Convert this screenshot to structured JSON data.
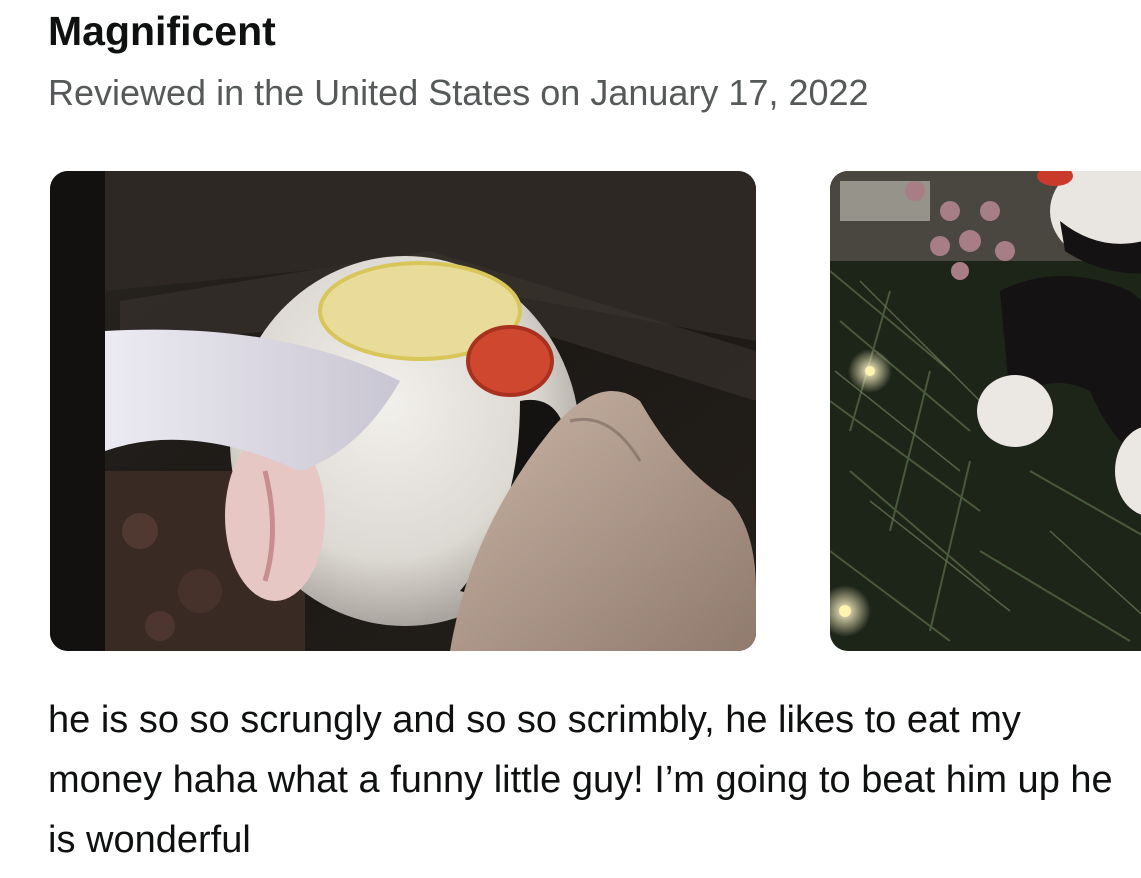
{
  "review": {
    "title": "Magnificent",
    "date_line": "Reviewed in the United States on January 17, 2022",
    "images": [
      {
        "subject": "plush-toy-held-in-hand-photo"
      },
      {
        "subject": "plush-toy-on-christmas-tree-photo"
      }
    ],
    "body": "he is so so scrungly and so so scrimbly, he likes to eat my money haha what a funny little guy! I’m going to beat him up he is wonderful"
  }
}
